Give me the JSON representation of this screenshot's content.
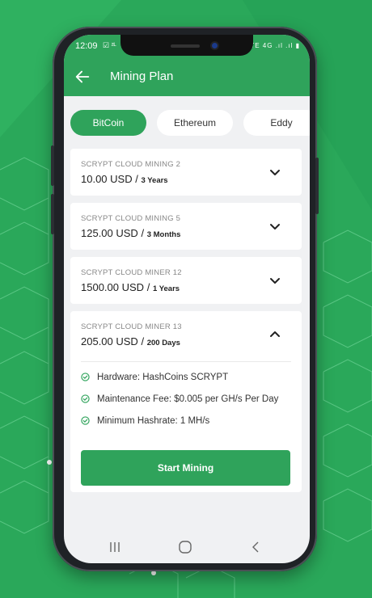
{
  "status_bar": {
    "time": "12:09",
    "left_icons": "☑ ²ᴸ",
    "right_icons": "VoLTE 4G .ıl .ıl ▮"
  },
  "app_bar": {
    "title": "Mining Plan",
    "back_icon": "arrow-left-icon"
  },
  "tabs": [
    {
      "label": "BitCoin",
      "active": true
    },
    {
      "label": "Ethereum",
      "active": false
    },
    {
      "label": "Eddy",
      "active": false
    }
  ],
  "plans": [
    {
      "name": "SCRYPT CLOUD MINING 2",
      "price": "10.00 USD",
      "separator": "/",
      "term": "3 Years",
      "expanded": false
    },
    {
      "name": "SCRYPT CLOUD MINING 5",
      "price": "125.00 USD",
      "separator": "/",
      "term": "3 Months",
      "expanded": false
    },
    {
      "name": "SCRYPT CLOUD MINER 12",
      "price": "1500.00 USD",
      "separator": "/",
      "term": "1 Years",
      "expanded": false
    },
    {
      "name": "SCRYPT CLOUD MINER 13",
      "price": "205.00 USD",
      "separator": "/",
      "term": "200 Days",
      "expanded": true,
      "features": [
        "Hardware: HashCoins SCRYPT",
        "Maintenance Fee: $0.005 per GH/s Per Day",
        "Minimum Hashrate: 1 MH/s"
      ],
      "button_label": "Start Mining"
    }
  ],
  "nav_bar": {
    "items": [
      "recents-icon",
      "home-icon",
      "back-icon"
    ]
  },
  "colors": {
    "brand_green": "#2fa35b",
    "background_green": "#2aa85a"
  }
}
